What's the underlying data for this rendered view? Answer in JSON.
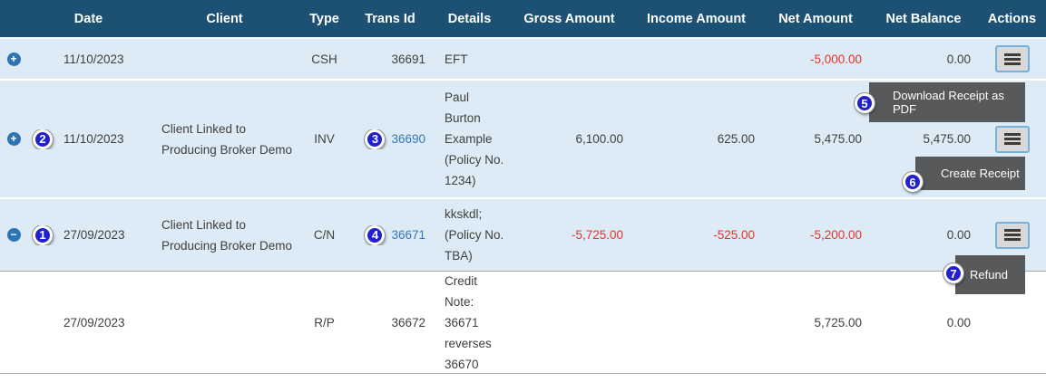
{
  "header": {
    "columns": {
      "date": "Date",
      "client": "Client",
      "type": "Type",
      "trans_id": "Trans Id",
      "details": "Details",
      "gross": "Gross Amount",
      "income": "Income Amount",
      "net": "Net Amount",
      "balance": "Net Balance",
      "actions": "Actions"
    }
  },
  "rows": [
    {
      "expander": "+",
      "badge": "",
      "date": "11/10/2023",
      "client": "",
      "type": "CSH",
      "trans_badge": "",
      "trans_id": "36691",
      "details": "EFT",
      "gross": "",
      "income": "",
      "net": "-5,000.00",
      "balance": "0.00"
    },
    {
      "expander": "+",
      "badge": "2",
      "date": "11/10/2023",
      "client": "Client Linked to\nProducing Broker Demo",
      "type": "INV",
      "trans_badge": "3",
      "trans_id": "36690",
      "details": "Paul\nBurton\nExample\n(Policy No.\n1234)",
      "gross": "6,100.00",
      "income": "625.00",
      "net": "5,475.00",
      "balance": "5,475.00"
    },
    {
      "expander": "−",
      "badge": "1",
      "date": "27/09/2023",
      "client": "Client Linked to\nProducing Broker Demo",
      "type": "C/N",
      "trans_badge": "4",
      "trans_id": "36671",
      "details": "kkskdl;\n(Policy No.\nTBA)",
      "gross": "-5,725.00",
      "income": "-525.00",
      "net": "-5,200.00",
      "balance": "0.00"
    },
    {
      "expander": "",
      "badge": "",
      "date": "27/09/2023",
      "client": "",
      "type": "R/P",
      "trans_badge": "",
      "trans_id": "36672",
      "details": "Credit\nNote:\n36671\nreverses\n36670",
      "gross": "",
      "income": "",
      "net": "5,725.00",
      "balance": "0.00"
    }
  ],
  "tooltips": [
    {
      "badge": "5",
      "label": "Download Receipt as PDF"
    },
    {
      "badge": "6",
      "label": "Create Receipt"
    },
    {
      "badge": "7",
      "label": "Refund"
    }
  ],
  "colors": {
    "header_bg": "#1d5174",
    "row_bg": "#dcebf5",
    "negative_text": "#e8322a",
    "link_text": "#3278b8",
    "badge_bg": "#2120ce",
    "tooltip_bg": "#58595b"
  }
}
